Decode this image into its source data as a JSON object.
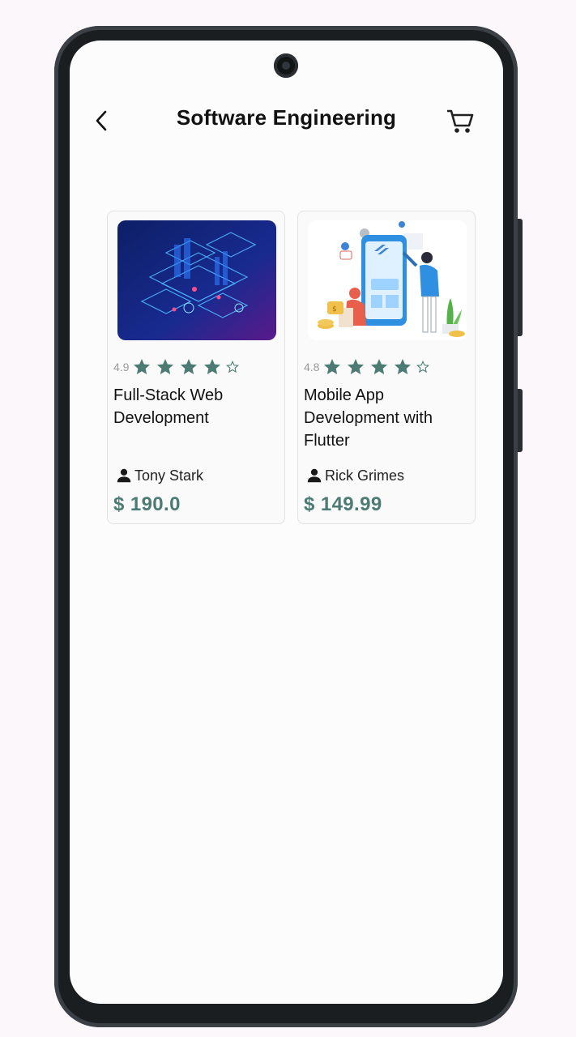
{
  "header": {
    "title": "Software Engineering",
    "back_icon": "chevron-left-icon",
    "cart_icon": "shopping-cart-icon"
  },
  "theme": {
    "accent": "#4b7b72",
    "star_color": "#4b7b72"
  },
  "courses": [
    {
      "rating": "4.9",
      "stars_filled": 4,
      "stars_total": 5,
      "title": "Full-Stack Web Development",
      "author": "Tony Stark",
      "price": "$ 190.0",
      "image": "isometric-web-development-illustration"
    },
    {
      "rating": "4.8",
      "stars_filled": 4,
      "stars_total": 5,
      "title": "Mobile App Development with Flutter",
      "author": "Rick Grimes",
      "price": "$ 149.99",
      "image": "flutter-mobile-app-illustration"
    }
  ]
}
